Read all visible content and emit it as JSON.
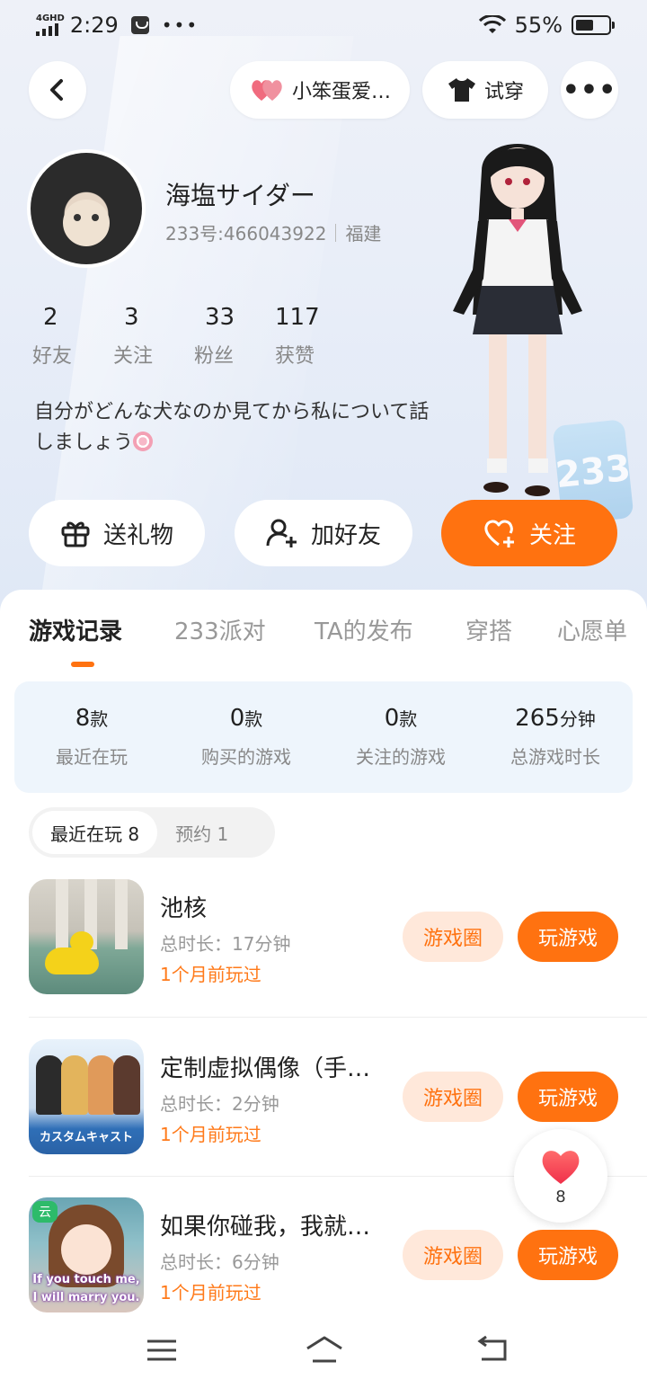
{
  "status_bar": {
    "network": "4GHD",
    "time": "2:29",
    "battery": "55%",
    "battery_level": 0.55
  },
  "header": {
    "friend_pill": "小笨蛋爱…",
    "try_on": "试穿"
  },
  "profile": {
    "name": "海塩サイダー",
    "uid": "233号:466043922",
    "region": "福建",
    "stats": [
      {
        "value": "2",
        "label": "好友"
      },
      {
        "value": "3",
        "label": "关注"
      },
      {
        "value": "33",
        "label": "粉丝"
      },
      {
        "value": "117",
        "label": "获赞"
      }
    ],
    "bio": "自分がどんな犬なのか見てから私について話しましょう"
  },
  "actions": {
    "gift": "送礼物",
    "add_friend": "加好友",
    "follow": "关注"
  },
  "tabs": [
    "游戏记录",
    "233派对",
    "TA的发布",
    "穿搭",
    "心愿单"
  ],
  "summary": [
    {
      "value": "8",
      "unit": "款",
      "label": "最近在玩"
    },
    {
      "value": "0",
      "unit": "款",
      "label": "购买的游戏"
    },
    {
      "value": "0",
      "unit": "款",
      "label": "关注的游戏"
    },
    {
      "value": "265",
      "unit": "分钟",
      "label": "总游戏时长"
    }
  ],
  "subtabs": [
    {
      "label": "最近在玩 8"
    },
    {
      "label": "预约 1"
    }
  ],
  "games": [
    {
      "title": "池核",
      "duration": "总时长：17分钟",
      "last_played": "1个月前玩过",
      "circle": "游戏圈",
      "play": "玩游戏"
    },
    {
      "title": "定制虚拟偶像（手…",
      "duration": "总时长：2分钟",
      "last_played": "1个月前玩过",
      "circle": "游戏圈",
      "play": "玩游戏",
      "icon_text": "カスタムキャスト"
    },
    {
      "title": "如果你碰我，我就…",
      "duration": "总时长：6分钟",
      "last_played": "1个月前玩过",
      "circle": "游戏圈",
      "play": "玩游戏",
      "icon_badge": "云",
      "icon_caption_1": "If you touch me,",
      "icon_caption_2": "I will marry you."
    }
  ],
  "like_float": {
    "count": "8"
  },
  "deco_text": "233",
  "colors": {
    "accent": "#ff7210",
    "accent_light": "#ffe8da",
    "summary_bg": "#eef5fc"
  }
}
